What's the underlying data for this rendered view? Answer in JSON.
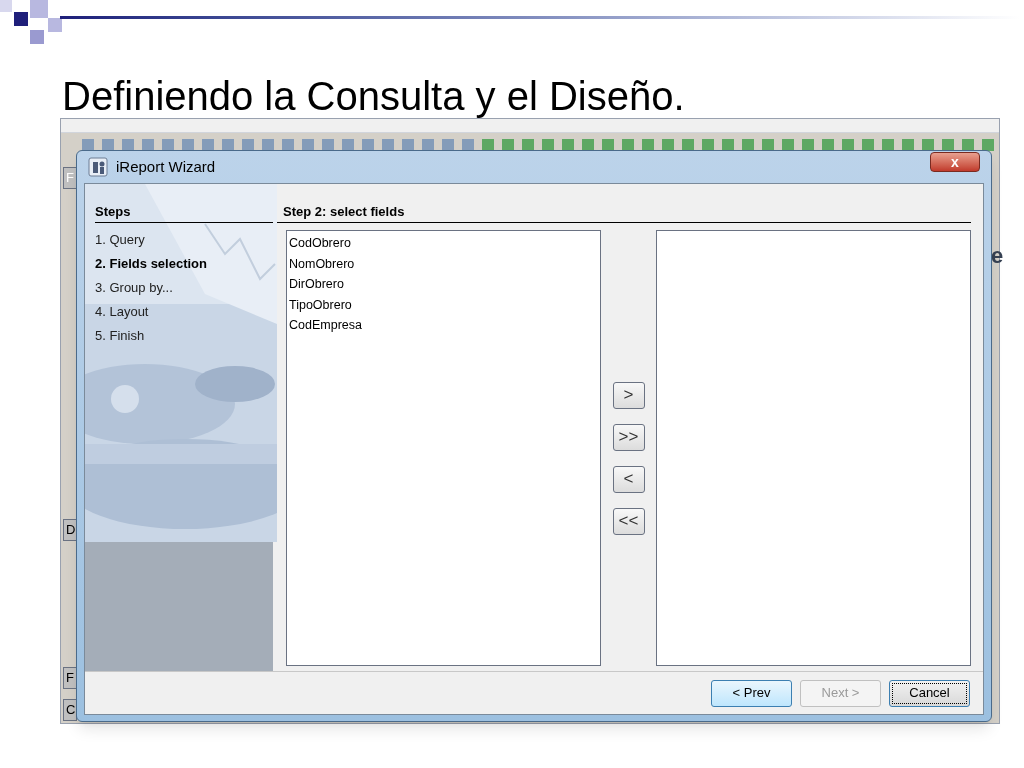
{
  "slide": {
    "title": "Definiendo la Consulta y el Diseño."
  },
  "background_app": {
    "edge_labels": [
      "F",
      "D",
      "F",
      "C"
    ],
    "right_fragment": "e"
  },
  "window": {
    "title": "iReport Wizard",
    "close": "x"
  },
  "steps": {
    "heading": "Steps",
    "items": [
      {
        "label": "1. Query",
        "selected": false
      },
      {
        "label": "2. Fields selection",
        "selected": true
      },
      {
        "label": "3. Group by...",
        "selected": false
      },
      {
        "label": "4. Layout",
        "selected": false
      },
      {
        "label": "5. Finish",
        "selected": false
      }
    ]
  },
  "step_title": "Step 2: select fields",
  "available_fields": [
    "CodObrero",
    "NomObrero",
    "DirObrero",
    "TipoObrero",
    "CodEmpresa"
  ],
  "move_buttons": [
    ">",
    ">>",
    "<",
    "<<"
  ],
  "buttons": [
    {
      "label": "< Prev",
      "disabled": false,
      "focused": false
    },
    {
      "label": "Next >",
      "disabled": true,
      "focused": false
    },
    {
      "label": "Cancel",
      "disabled": false,
      "focused": true
    }
  ]
}
